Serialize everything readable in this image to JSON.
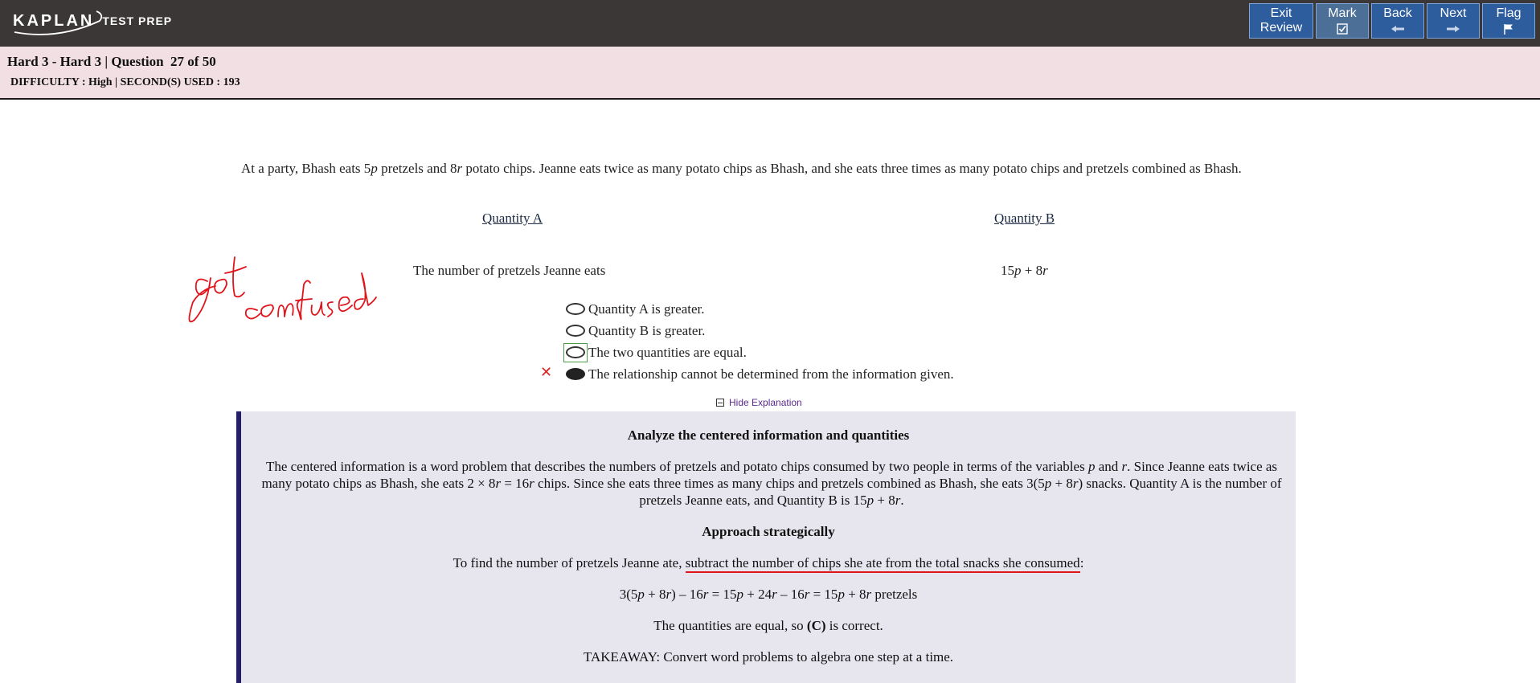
{
  "app": {
    "logo_main": "KAPLAN",
    "logo_sub": "TEST PREP"
  },
  "toolbar": {
    "exit_line1": "Exit",
    "exit_line2": "Review",
    "mark_label": "Mark",
    "back_label": "Back",
    "next_label": "Next",
    "flag_label": "Flag"
  },
  "info": {
    "title": "Hard 3 - Hard 3 | Question  27 of 50",
    "meta": "DIFFICULTY : High | SECOND(S) USED : 193"
  },
  "question": {
    "stem_parts": [
      "At a party, Bhash eats 5",
      "p",
      " pretzels and 8",
      "r",
      " potato chips. Jeanne eats twice as many potato chips as Bhash, and she eats three times as many potato chips and pretzels combined as Bhash."
    ],
    "quantity_a_label": "Quantity A",
    "quantity_b_label": "Quantity B",
    "quantity_a_value": "The number of pretzels Jeanne eats",
    "quantity_b_value_parts": [
      "15",
      "p",
      " + 8",
      "r"
    ],
    "choices": [
      {
        "label": "Quantity A is greater.",
        "selected": false
      },
      {
        "label": "Quantity B is greater.",
        "selected": false
      },
      {
        "label": "The two quantities are equal.",
        "selected": false,
        "correct": true
      },
      {
        "label": "The relationship cannot be determined from the information given.",
        "selected": true,
        "wrong": true
      }
    ],
    "wrong_marker": "✕"
  },
  "explanation": {
    "toggle_label": "Hide Explanation",
    "heading1": "Analyze the centered information and quantities",
    "para1": "The centered information is a word problem that describes the numbers of pretzels and potato chips consumed by two people in terms of the variables p and r. Since Jeanne eats twice as many potato chips as Bhash, she eats 2 × 8r = 16r chips. Since she eats three times as many chips and pretzels combined as Bhash, she eats 3(5p + 8r) snacks. Quantity A is the number of pretzels Jeanne eats, and Quantity B is 15p + 8r.",
    "heading2": "Approach strategically",
    "para2_prefix": "To find the number of pretzels Jeanne ate, ",
    "para2_underlined": "subtract the number of chips she ate from the total snacks she consumed",
    "para2_suffix": ":",
    "equation": "3(5p + 8r) – 16r = 15p + 24r – 16r = 15p + 8r pretzels",
    "conclusion_prefix": "The quantities are equal, so ",
    "conclusion_bold": "(C)",
    "conclusion_suffix": " is correct.",
    "takeaway": "TAKEAWAY: Convert word problems to algebra one step at a time."
  },
  "annotation": {
    "handwriting": "got confused",
    "ink_color": "#e0141b"
  },
  "colors": {
    "topbar": "#3a3736",
    "button": "#2e5d9e",
    "infobar": "#f1dfe3",
    "explanation_bg": "#e7e6ef",
    "explanation_border": "#221f66"
  }
}
